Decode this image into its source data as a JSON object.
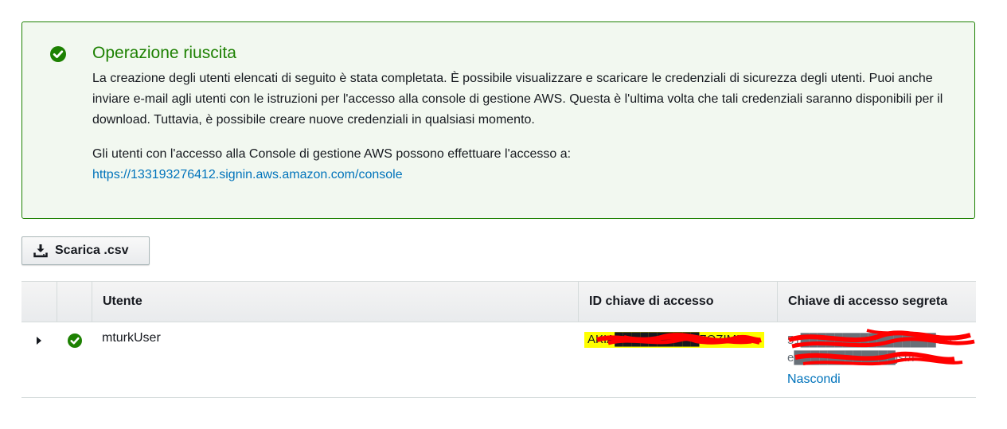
{
  "alert": {
    "type": "success",
    "icon": "check-circle-icon",
    "accent_color": "#1d8102",
    "title": "Operazione riuscita",
    "message": "La creazione degli utenti elencati di seguito è stata completata. È possibile visualizzare e scaricare le credenziali di sicurezza degli utenti. Puoi anche inviare e-mail agli utenti con le istruzioni per l'accesso alla console di gestione AWS. Questa è l'ultima volta che tali credenziali saranno disponibili per il download. Tuttavia, è possibile creare nuove credenziali in qualsiasi momento.",
    "console_text": "Gli utenti con l'accesso alla Console di gestione AWS possono effettuare l'accesso a:",
    "console_url": "https://133193276412.signin.aws.amazon.com/console"
  },
  "toolbar": {
    "download_label": "Scarica .csv",
    "download_icon": "download-icon"
  },
  "table": {
    "columns": [
      "",
      "",
      "Utente",
      "ID chiave di accesso",
      "Chiave di accesso segreta"
    ],
    "rows": [
      {
        "status_icon": "check-circle-icon",
        "user": "mturkUser",
        "access_key_id": "AKIA██████████ZOZIML",
        "secret_key_line1": "51████████████████OR",
        "secret_key_line2": "e████████████jsr/f",
        "hide_label": "Nascondi"
      }
    ]
  },
  "redaction": {
    "highlight_color": "#ffff00",
    "scribble_color": "#ff0000"
  }
}
